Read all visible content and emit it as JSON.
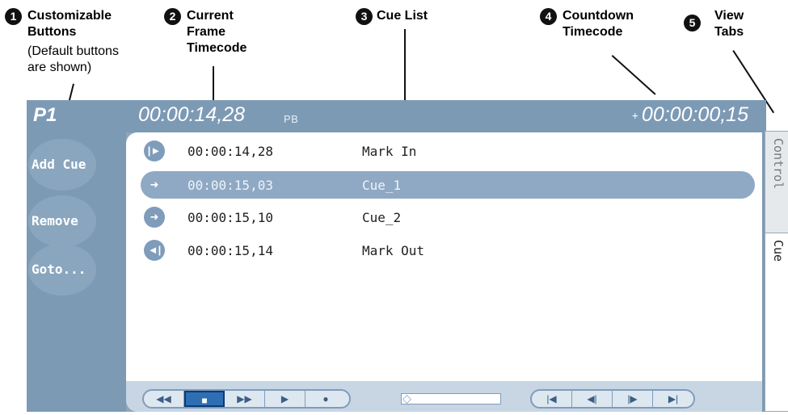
{
  "callouts": [
    {
      "number": "1",
      "title": "Customizable\nButtons",
      "subtitle": "(Default buttons\nare shown)"
    },
    {
      "number": "2",
      "title": "Current\nFrame\nTimecode"
    },
    {
      "number": "3",
      "title": "Cue List"
    },
    {
      "number": "4",
      "title": "Countdown\nTimecode"
    },
    {
      "number": "5",
      "title": "View\nTabs"
    }
  ],
  "header": {
    "port": "P1",
    "current_timecode": "00:00:14,28",
    "mode": "PB",
    "countdown_arrow": "+",
    "countdown_timecode": "00:00:00;15"
  },
  "buttons": [
    "Add Cue",
    "Remove",
    "Goto..."
  ],
  "cues": [
    {
      "icon": "mark-in-icon",
      "glyph": "|►",
      "timecode": "00:00:14,28",
      "name": "Mark In",
      "selected": false
    },
    {
      "icon": "cue-arrow-icon",
      "glyph": "➜",
      "timecode": "00:00:15,03",
      "name": "Cue_1",
      "selected": true
    },
    {
      "icon": "cue-arrow-icon",
      "glyph": "➜",
      "timecode": "00:00:15,10",
      "name": "Cue_2",
      "selected": false
    },
    {
      "icon": "mark-out-icon",
      "glyph": "◄|",
      "timecode": "00:00:15,14",
      "name": "Mark Out",
      "selected": false
    }
  ],
  "transport": {
    "group1": [
      {
        "name": "rewind-button",
        "glyph": "◀◀",
        "active": false
      },
      {
        "name": "stop-button",
        "glyph": "■",
        "active": true
      },
      {
        "name": "fast-forward-button",
        "glyph": "▶▶",
        "active": false
      },
      {
        "name": "play-button",
        "glyph": "▶",
        "active": false
      },
      {
        "name": "record-button",
        "glyph": "●",
        "active": false
      }
    ],
    "group2": [
      {
        "name": "go-to-start-button",
        "glyph": "|◀",
        "active": false
      },
      {
        "name": "step-back-button",
        "glyph": "◀|",
        "active": false
      },
      {
        "name": "step-forward-button",
        "glyph": "|▶",
        "active": false
      },
      {
        "name": "go-to-end-button",
        "glyph": "▶|",
        "active": false
      }
    ]
  },
  "tabs": [
    {
      "label": "Control",
      "active": false
    },
    {
      "label": "Cue",
      "active": true
    }
  ],
  "colors": {
    "panel": "#7d9ab5",
    "selection": "#8fa9c4",
    "accent": "#2e6fb3"
  }
}
